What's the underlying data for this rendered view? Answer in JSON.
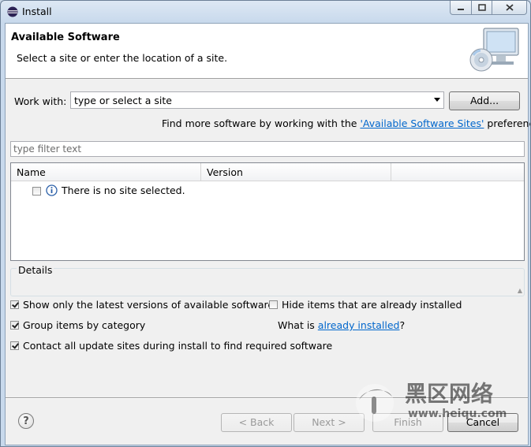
{
  "window": {
    "title": "Install"
  },
  "banner": {
    "title": "Available Software",
    "subtitle": "Select a site or enter the location of a site."
  },
  "work_with": {
    "label": "Work with:",
    "value": "type or select a site",
    "add_label": "Add..."
  },
  "find_more": {
    "prefix": "Find more software by working with the ",
    "link": "'Available Software Sites'",
    "suffix": " preferences."
  },
  "filter": {
    "placeholder": "type filter text"
  },
  "tree": {
    "columns": [
      "Name",
      "Version"
    ],
    "rows": [
      {
        "icon": "info-icon",
        "text": "There is no site selected.",
        "checked": false
      }
    ]
  },
  "details": {
    "label": "Details"
  },
  "options": {
    "show_latest": {
      "label": "Show only the latest versions of available software",
      "checked": true
    },
    "hide_installed": {
      "label": "Hide items that are already installed",
      "checked": false
    },
    "group_by_category": {
      "label": "Group items by category",
      "checked": true
    },
    "what_is_prefix": "What is ",
    "what_is_link": "already installed",
    "what_is_suffix": "?",
    "contact_sites": {
      "label": "Contact all update sites during install to find required software",
      "checked": true
    }
  },
  "footer": {
    "help_glyph": "?",
    "back_label": "< Back",
    "next_label": "Next >",
    "finish_label": "Finish",
    "cancel_label": "Cancel"
  },
  "watermark": {
    "text": "黑区网络",
    "url_text": "www.heiqu.com"
  },
  "colors": {
    "link": "#0066cc",
    "titlebar": "#c8d9ec",
    "client_bg": "#f0f0f0"
  }
}
